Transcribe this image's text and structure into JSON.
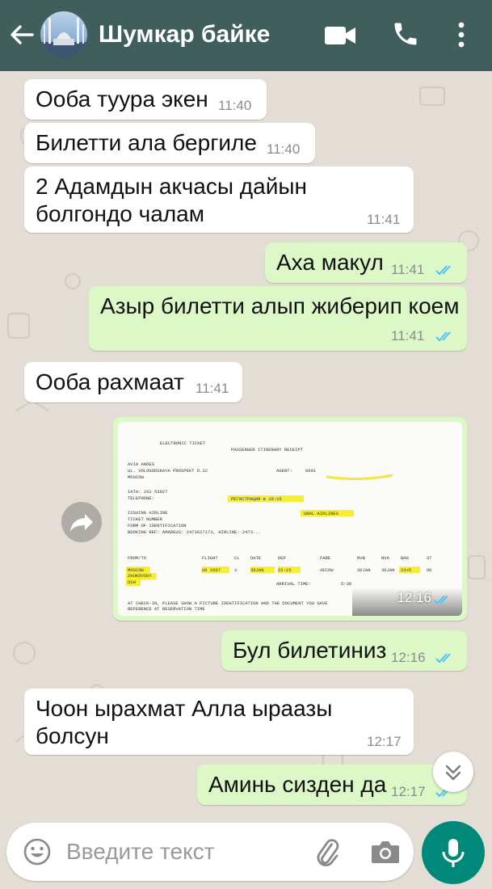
{
  "header": {
    "contact_name": "Шумкар байке"
  },
  "messages": [
    {
      "text": "Ооба туура экен",
      "time": "11:40"
    },
    {
      "text": "Билетти ала бергиле",
      "time": "11:40"
    },
    {
      "text": "2 Адамдын акчасы дайын болгондо чалам",
      "time": "11:41"
    },
    {
      "text": "Аха макул",
      "time": "11:41"
    },
    {
      "text": "Азыр билетти алып жиберип коем",
      "time": "11:41"
    },
    {
      "text": "Ооба рахмаат",
      "time": "11:41"
    },
    {
      "text": "Бул билетиниз",
      "time": "12:16"
    },
    {
      "text": "Чоон ырахмат Алла ыраазы болсун",
      "time": "12:17"
    },
    {
      "text": "Аминь сизден да",
      "time": "12:17"
    }
  ],
  "image_message": {
    "time": "12:16",
    "ticket": {
      "title": "ELECTRONIC TICKET",
      "subtitle": "PASSENGER ITINERARY RECEIPT",
      "agency": "AVIA ANDES",
      "address": "UL. VOLOGODSKAYA PROSPEKT D.32",
      "city": "MOSCOW",
      "agent_label": "AGENT:",
      "agent_value": "0001",
      "iata": "IATA: 262 53927",
      "telephone": "TELEPHONE:",
      "registration": "РЕГИСТРАЦИЯ в 19:15",
      "issuing": "ISSUING AIRLINE",
      "ticket_number": "TICKET NUMBER",
      "form_id": "FORM OF IDENTIFICATION",
      "booking": "BOOKING REF: AMADEUS: 2473627173, AIRLINE: 2473...",
      "airline": "URAL AIRLINES",
      "cols": [
        "FROM/TO",
        "FLIGHT",
        "CL",
        "DATE",
        "DEP",
        "FARE",
        "NVB",
        "NVA",
        "BAG",
        "ST"
      ],
      "row1": [
        "MOSCOW",
        "U6 2667",
        "X",
        "30JAN",
        "22:15",
        "XECOW",
        "30JAN",
        "30JAN",
        "23+5",
        "OK"
      ],
      "row2": [
        "ZHUKOVSKY",
        "OSH"
      ],
      "arrival": "ARRIVAL TIME:",
      "arrival_value": "5:30",
      "footer1": "AT CHECK-IN, PLEASE SHOW A PICTURE IDENTIFICATION AND THE DOCUMENT YOU GAVE",
      "footer2": "REFERENCE AT RESERVATION TIME"
    }
  },
  "input": {
    "placeholder": "Введите текст"
  },
  "colors": {
    "header": "#3f5e5c",
    "incoming": "#ffffff",
    "outgoing": "#dcf8c6",
    "read_ticks": "#4fc3f7",
    "mic_button": "#00897b"
  }
}
